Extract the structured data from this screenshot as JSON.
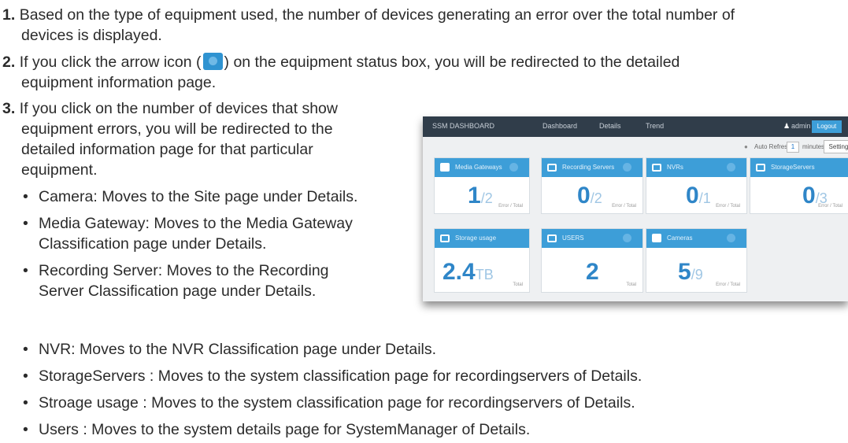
{
  "items": [
    {
      "num": "1.",
      "text": "Based on the type of equipment used, the number of devices generating an error over the total number of",
      "text2": "devices is displayed."
    },
    {
      "num": "2.",
      "text_before": "If you click the arrow icon (",
      "text_after": ") on the equipment status box, you will be redirected to the detailed",
      "text2": "equipment information page."
    },
    {
      "num": "3.",
      "lines": [
        "If you click on the number of devices that show",
        "equipment errors, you will be redirected to the",
        "detailed information page for that particular",
        "equipment."
      ]
    }
  ],
  "bullets": [
    {
      "lines": [
        "Camera: Moves to the Site page under Details."
      ]
    },
    {
      "lines": [
        "Media Gateway: Moves to the Media Gateway",
        "Classification page under Details."
      ]
    },
    {
      "lines": [
        "Recording Server: Moves to the Recording",
        "Server Classification page under Details."
      ]
    },
    {
      "lines": [
        "NVR: Moves to the NVR Classification page under Details."
      ]
    },
    {
      "lines": [
        "StorageServers : Moves to the system classification page for recordingservers of Details."
      ]
    },
    {
      "lines": [
        "Stroage usage : Moves to the system classification page for recordingservers of Details."
      ]
    },
    {
      "lines": [
        "Users : Moves to the system details page for SystemManager of Details."
      ]
    }
  ],
  "dashboard": {
    "brand": "SSM DASHBOARD",
    "nav": [
      "Dashboard",
      "Details",
      "Trend"
    ],
    "user": "admin",
    "logout": "Logout",
    "auto_refresh_label": "Auto Refresh",
    "refresh_value": "1",
    "minutes_label": "minutes",
    "setting_label": "Setting",
    "cards": [
      {
        "title": "Media Gateways",
        "value": "1",
        "total": "/2",
        "caption": "Error / Total",
        "icon": "play-icon"
      },
      {
        "title": "Recording Servers",
        "value": "0",
        "total": "/2",
        "caption": "Error / Total",
        "icon": "server-icon"
      },
      {
        "title": "NVRs",
        "value": "0",
        "total": "/1",
        "caption": "Error / Total",
        "icon": "server-icon"
      },
      {
        "title": "StorageServers",
        "value": "0",
        "total": "/3",
        "caption": "Error / Total",
        "icon": "server-icon"
      },
      {
        "title": "Storage usage",
        "value": "2.4",
        "total": "TB",
        "caption": "Total",
        "icon": "server-icon"
      },
      {
        "title": "USERS",
        "value": "2",
        "total": "",
        "caption": "Total",
        "icon": "server-icon"
      },
      {
        "title": "Cameras",
        "value": "5",
        "total": "/9",
        "caption": "Error / Total",
        "icon": "camera-icon"
      }
    ]
  }
}
